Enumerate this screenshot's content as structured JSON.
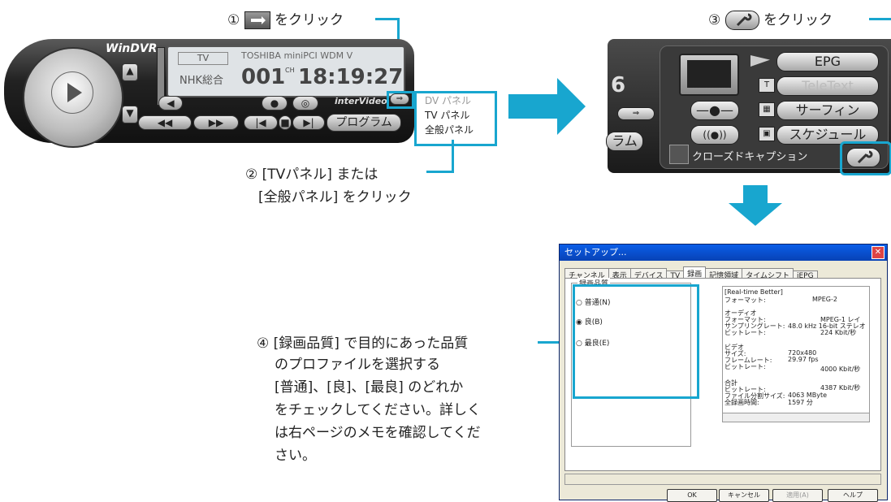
{
  "steps": {
    "s1_num": "①",
    "s1_text": "をクリック",
    "s2_line1": "② [TVパネル] または",
    "s2_line2": "[全般パネル] をクリック",
    "s3_num": "③",
    "s3_text": "をクリック",
    "s4_line1": "④ [録画品質] で目的にあった品質",
    "s4_line2": "のプロファイルを選択する",
    "s4_body1": "[普通]、[良]、[最良] のどれか",
    "s4_body2": "をチェックしてください。詳しく",
    "s4_body3": "は右ページのメモを確認してくだ",
    "s4_body4": "さい。"
  },
  "player": {
    "logo": "WinDVR",
    "channel_label": "TV",
    "station": "NHK総合",
    "device": "TOSHIBA miniPCI WDM V",
    "channel_number": "001",
    "channel_suffix": "CH",
    "clock": "18:19:27",
    "brand": "interVideo",
    "program_button": "プログラム",
    "menu_items": [
      "DV パネル",
      "TV パネル",
      "全般パネル"
    ]
  },
  "panel": {
    "epg": "EPG",
    "teletext": "TeleText",
    "surfing": "サーフィン",
    "schedule": "スケジュール",
    "caption": "クローズドキャプション",
    "digit": "6",
    "prog_frag": "ラム"
  },
  "dialog": {
    "title": "セットアップ...",
    "tabs": [
      "チャンネル",
      "表示",
      "デバイス",
      "TV",
      "録画",
      "記憶領域",
      "タイムシフト",
      "iEPG"
    ],
    "group_label": "録画品質",
    "radio_normal": "普通(N)",
    "radio_good": "良(B)",
    "radio_best": "最良(E)",
    "info": [
      [
        "[Real-time Better]",
        ""
      ],
      [
        "フォーマット:",
        "MPEG-2"
      ],
      [
        "オーディオ",
        ""
      ],
      [
        "フォーマット:",
        "MPEG-1 レイ"
      ],
      [
        "サンプリングレート:",
        "48.0 kHz 16-bit ステレオ"
      ],
      [
        "ビットレート:",
        "224 Kbit/秒"
      ],
      [
        "ビデオ",
        ""
      ],
      [
        "サイズ:",
        "720x480"
      ],
      [
        "フレームレート:",
        "29.97 fps"
      ],
      [
        "ビットレート:",
        "4000 Kbit/秒"
      ],
      [
        "合計",
        ""
      ],
      [
        "ビットレート:",
        "4387 Kbit/秒"
      ],
      [
        "ファイル分割サイズ:",
        "4063 MByte"
      ],
      [
        "全録画時間:",
        "1597 分"
      ]
    ],
    "btn_ok": "OK",
    "btn_cancel": "キャンセル",
    "btn_apply": "適用(A)",
    "btn_help": "ヘルプ"
  },
  "colors": {
    "accent": "#18a6cf"
  }
}
